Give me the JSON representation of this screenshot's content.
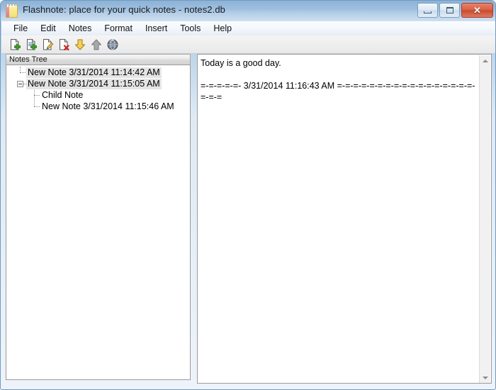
{
  "window": {
    "title": "Flashnote: place for your quick notes - notes2.db",
    "icon": "notepad-icon",
    "buttons": {
      "minimize": "minimize",
      "maximize": "maximize",
      "close": "✕"
    }
  },
  "menubar": {
    "items": [
      {
        "label": "File"
      },
      {
        "label": "Edit"
      },
      {
        "label": "Notes"
      },
      {
        "label": "Format"
      },
      {
        "label": "Insert"
      },
      {
        "label": "Tools"
      },
      {
        "label": "Help"
      }
    ]
  },
  "toolbar": {
    "buttons": [
      {
        "name": "new-note-icon",
        "tooltip": "New Note"
      },
      {
        "name": "new-child-note-icon",
        "tooltip": "New Child Note"
      },
      {
        "name": "edit-note-icon",
        "tooltip": "Edit Note"
      },
      {
        "name": "delete-note-icon",
        "tooltip": "Delete Note"
      },
      {
        "name": "move-down-icon",
        "tooltip": "Move Down"
      },
      {
        "name": "move-up-icon",
        "tooltip": "Move Up"
      },
      {
        "name": "globe-icon",
        "tooltip": "Web"
      }
    ]
  },
  "tree_panel": {
    "header": "Notes Tree",
    "nodes": [
      {
        "label": "New Note 3/31/2014 11:14:42 AM",
        "depth": 0,
        "selected": true,
        "expandable": false
      },
      {
        "label": "New Note 3/31/2014 11:15:05 AM",
        "depth": 0,
        "selected": true,
        "expandable": true
      },
      {
        "label": "Child Note",
        "depth": 1,
        "selected": false,
        "expandable": false
      },
      {
        "label": "New Note 3/31/2014 11:15:46 AM",
        "depth": 1,
        "selected": false,
        "expandable": false
      }
    ]
  },
  "editor": {
    "content": "Today is a good day.\n\n=-=-=-=-=- 3/31/2014 11:16:43 AM =-=-=-=-=-=-=-=-=-=-=-=-=-=-=-=-=-=-=-=",
    "scrollbar": {
      "up_arrow": "▲",
      "down_arrow": "▼"
    }
  },
  "colors": {
    "titlebar_top": "#8eb3d6",
    "titlebar_bottom": "#cfe0f0",
    "close_button": "#d85f44",
    "window_border": "#6f9bc4",
    "selection": "#e4e4e4",
    "toolbar_bg": "#efefef"
  }
}
